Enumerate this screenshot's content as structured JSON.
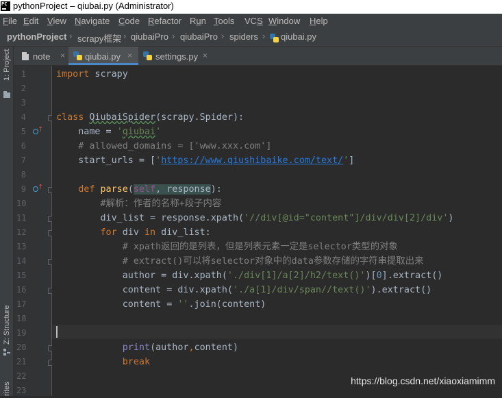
{
  "window": {
    "title": "pythonProject – qiubai.py (Administrator)",
    "app_icon_text": "PC"
  },
  "menu": [
    {
      "pre": "",
      "u": "F",
      "post": "ile"
    },
    {
      "pre": "",
      "u": "E",
      "post": "dit"
    },
    {
      "pre": "",
      "u": "V",
      "post": "iew"
    },
    {
      "pre": "",
      "u": "N",
      "post": "avigate"
    },
    {
      "pre": "",
      "u": "C",
      "post": "ode"
    },
    {
      "pre": "",
      "u": "R",
      "post": "efactor"
    },
    {
      "pre": "R",
      "u": "u",
      "post": "n"
    },
    {
      "pre": "",
      "u": "T",
      "post": "ools"
    },
    {
      "pre": "VC",
      "u": "S",
      "post": ""
    },
    {
      "pre": "",
      "u": "W",
      "post": "indow"
    },
    {
      "pre": "",
      "u": "H",
      "post": "elp"
    }
  ],
  "breadcrumbs": [
    "pythonProject",
    "scrapy框架",
    "qiubaiPro",
    "qiubaiPro",
    "spiders",
    "qiubai.py"
  ],
  "side_tabs": {
    "project": "1: Project",
    "structure": "Z: Structure",
    "favorites": "rites"
  },
  "tabs": [
    {
      "label": "note",
      "active": false
    },
    {
      "label": "qiubai.py",
      "active": true
    },
    {
      "label": "settings.py",
      "active": false
    }
  ],
  "line_numbers": [
    "1",
    "2",
    "3",
    "4",
    "5",
    "6",
    "7",
    "8",
    "9",
    "10",
    "11",
    "12",
    "13",
    "14",
    "15",
    "16",
    "17",
    "18",
    "19",
    "20",
    "21",
    "22",
    "23"
  ],
  "code_lines": [
    [
      [
        "import",
        "kw"
      ],
      [
        " scrapy",
        ""
      ]
    ],
    [],
    [],
    [
      [
        "class",
        "kw"
      ],
      [
        " ",
        ""
      ],
      [
        "QiubaiSpider",
        "spell"
      ],
      [
        "(scrapy.Spider):",
        ""
      ]
    ],
    [
      [
        "    name = ",
        ""
      ],
      [
        "'",
        "str"
      ],
      [
        "qiubai",
        "str spell"
      ],
      [
        "'",
        "str"
      ]
    ],
    [
      [
        "    # allowed_domains = ['www.xxx.com']",
        "cm"
      ]
    ],
    [
      [
        "    start_urls = [",
        ""
      ],
      [
        "'",
        "str"
      ],
      [
        "https://www.qiushibaike.com/text/",
        "lnk"
      ],
      [
        "'",
        "str"
      ],
      [
        "]",
        ""
      ]
    ],
    [],
    [
      [
        "    ",
        ""
      ],
      [
        "def",
        "kw"
      ],
      [
        " ",
        ""
      ],
      [
        "parse",
        "fn"
      ],
      [
        "(",
        ""
      ],
      [
        "self",
        "slf hl"
      ],
      [
        ", response",
        "hl"
      ],
      [
        "):",
        ""
      ]
    ],
    [
      [
        "        #解析：作者的名称+段子内容",
        "cm"
      ]
    ],
    [
      [
        "        div_list = response.xpath(",
        ""
      ],
      [
        "'//div[@id=\"content\"]/div/div[2]/div'",
        "str"
      ],
      [
        ")",
        ""
      ]
    ],
    [
      [
        "        ",
        ""
      ],
      [
        "for",
        "kw"
      ],
      [
        " div ",
        ""
      ],
      [
        "in",
        "kw"
      ],
      [
        " div_list:",
        ""
      ]
    ],
    [
      [
        "            # xpath返回的是列表，但是列表元素一定是selector类型的对象",
        "cm"
      ]
    ],
    [
      [
        "            # extract()可以将selector对象中的data参数存储的字符串提取出来",
        "cm"
      ]
    ],
    [
      [
        "            author = div.xpath(",
        ""
      ],
      [
        "'./div[1]/a[2]/h2/text()'",
        "str"
      ],
      [
        ")[",
        ""
      ],
      [
        "0",
        "num"
      ],
      [
        "].extract()",
        ""
      ]
    ],
    [
      [
        "            content = div.xpath(",
        ""
      ],
      [
        "'./a[1]/div/span//text()'",
        "str"
      ],
      [
        ").extract()",
        ""
      ]
    ],
    [
      [
        "            content = ",
        ""
      ],
      [
        "''",
        "str"
      ],
      [
        ".join(content)",
        ""
      ]
    ],
    [],
    [],
    [
      [
        "            ",
        ""
      ],
      [
        "print",
        "bi"
      ],
      [
        "(author",
        ""
      ],
      [
        ",",
        "kw"
      ],
      [
        "content)",
        ""
      ]
    ],
    [
      [
        "            ",
        ""
      ],
      [
        "break",
        "kw"
      ]
    ],
    [],
    []
  ],
  "watermark": "https://blog.csdn.net/xiaoxiamimm",
  "colors": {
    "editor_bg": "#2b2b2b",
    "keyword": "#cc7832",
    "string": "#6a8759",
    "comment": "#808080",
    "function": "#ffc66d",
    "number": "#6897bb",
    "self": "#94558d",
    "builtin": "#8888c6",
    "link": "#287bde",
    "tab_underline": "#4a88c7"
  }
}
